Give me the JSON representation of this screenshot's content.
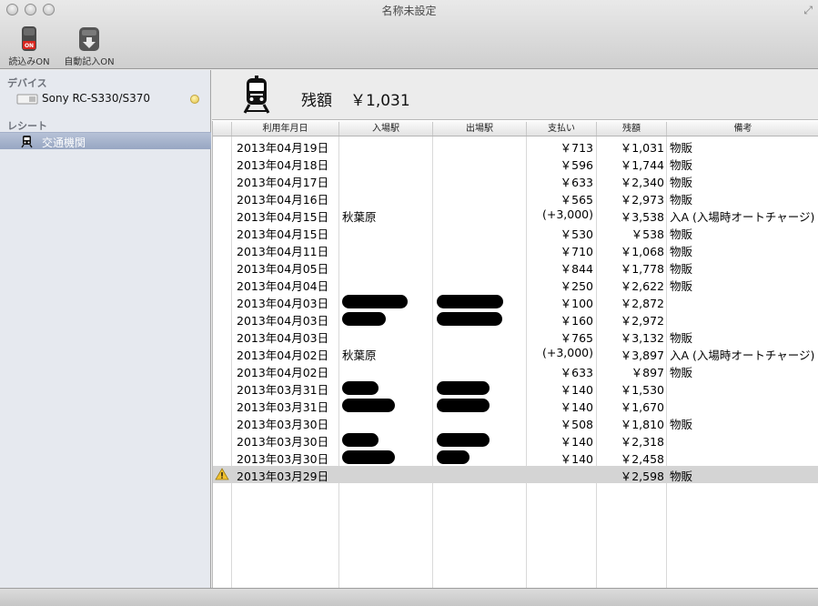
{
  "window": {
    "title": "名称未設定"
  },
  "toolbar": {
    "read_label": "読込みON",
    "autolog_label": "自動記入ON",
    "read_badge": "ON"
  },
  "sidebar": {
    "devices_header": "デバイス",
    "device_name": "Sony RC-S330/S370",
    "receipts_header": "レシート",
    "receipt_item": "交通機関"
  },
  "balance": {
    "label": "残額",
    "value": "￥1,031"
  },
  "table": {
    "columns": [
      "利用年月日",
      "入場駅",
      "出場駅",
      "支払い",
      "残額",
      "備考"
    ],
    "rows": [
      {
        "date": "2013年04月19日",
        "in": "",
        "out": "",
        "pay": "￥713",
        "bal": "￥1,031",
        "note": "物販"
      },
      {
        "date": "2013年04月18日",
        "in": "",
        "out": "",
        "pay": "￥596",
        "bal": "￥1,744",
        "note": "物販"
      },
      {
        "date": "2013年04月17日",
        "in": "",
        "out": "",
        "pay": "￥633",
        "bal": "￥2,340",
        "note": "物販"
      },
      {
        "date": "2013年04月16日",
        "in": "",
        "out": "",
        "pay": "￥565",
        "bal": "￥2,973",
        "note": "物販"
      },
      {
        "date": "2013年04月15日",
        "in": "秋葉原",
        "out": "",
        "pay": "(+3,000)",
        "bal": "￥3,538",
        "note": "入A (入場時オートチャージ)"
      },
      {
        "date": "2013年04月15日",
        "in": "",
        "out": "",
        "pay": "￥530",
        "bal": "￥538",
        "note": "物販"
      },
      {
        "date": "2013年04月11日",
        "in": "",
        "out": "",
        "pay": "￥710",
        "bal": "￥1,068",
        "note": "物販"
      },
      {
        "date": "2013年04月05日",
        "in": "",
        "out": "",
        "pay": "￥844",
        "bal": "￥1,778",
        "note": "物販"
      },
      {
        "date": "2013年04月04日",
        "in": "",
        "out": "",
        "pay": "￥250",
        "bal": "￥2,622",
        "note": "物販"
      },
      {
        "date": "2013年04月03日",
        "in": "",
        "out": "",
        "pay": "￥100",
        "bal": "￥2,872",
        "note": ""
      },
      {
        "date": "2013年04月03日",
        "in": "",
        "out": "",
        "pay": "￥160",
        "bal": "￥2,972",
        "note": ""
      },
      {
        "date": "2013年04月03日",
        "in": "",
        "out": "",
        "pay": "￥765",
        "bal": "￥3,132",
        "note": "物販"
      },
      {
        "date": "2013年04月02日",
        "in": "秋葉原",
        "out": "",
        "pay": "(+3,000)",
        "bal": "￥3,897",
        "note": "入A (入場時オートチャージ)"
      },
      {
        "date": "2013年04月02日",
        "in": "",
        "out": "",
        "pay": "￥633",
        "bal": "￥897",
        "note": "物販"
      },
      {
        "date": "2013年03月31日",
        "in": "",
        "out": "",
        "pay": "￥140",
        "bal": "￥1,530",
        "note": ""
      },
      {
        "date": "2013年03月31日",
        "in": "",
        "out": "",
        "pay": "￥140",
        "bal": "￥1,670",
        "note": ""
      },
      {
        "date": "2013年03月30日",
        "in": "",
        "out": "",
        "pay": "￥508",
        "bal": "￥1,810",
        "note": "物販"
      },
      {
        "date": "2013年03月30日",
        "in": "",
        "out": "",
        "pay": "￥140",
        "bal": "￥2,318",
        "note": ""
      },
      {
        "date": "2013年03月30日",
        "in": "",
        "out": "",
        "pay": "￥140",
        "bal": "￥2,458",
        "note": ""
      },
      {
        "date": "2013年03月29日",
        "in": "",
        "out": "",
        "pay": "",
        "bal": "￥2,598",
        "note": "物販"
      }
    ]
  }
}
